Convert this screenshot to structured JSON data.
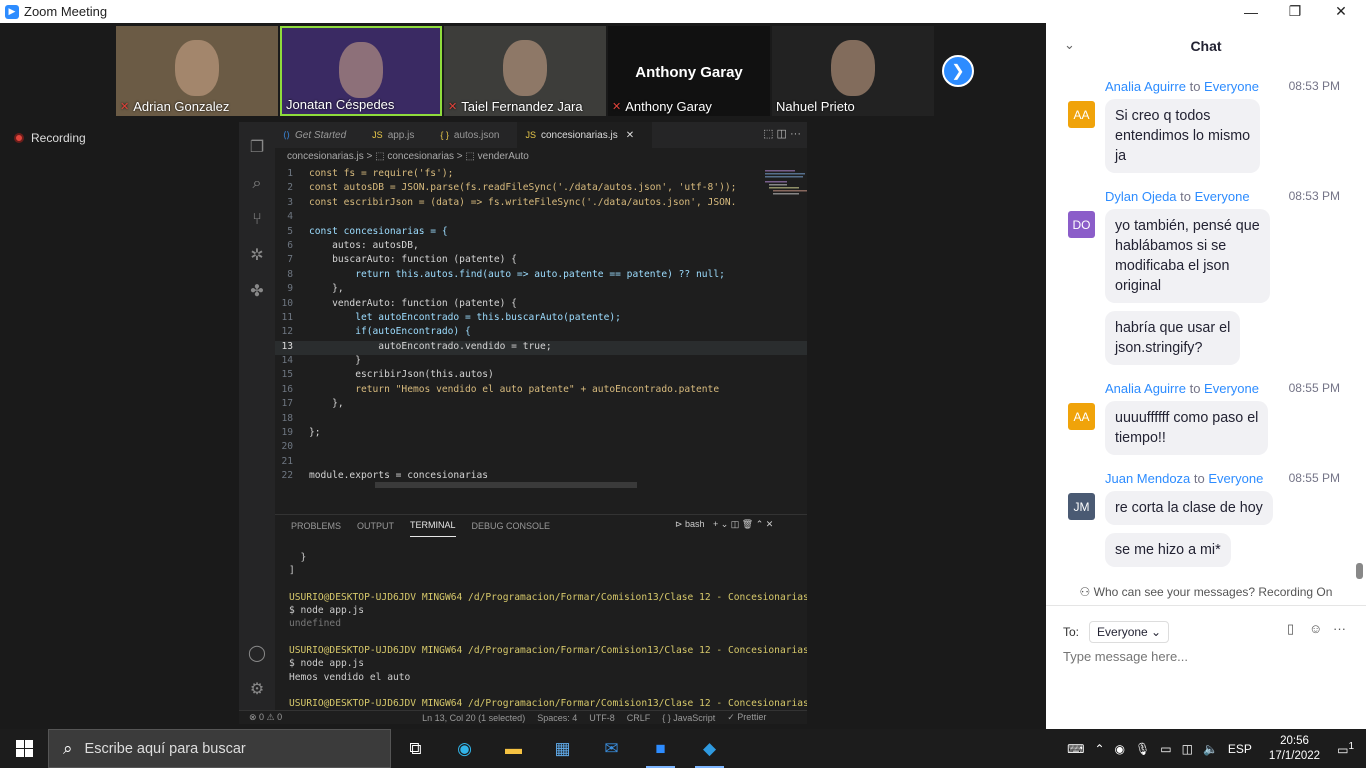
{
  "window": {
    "title": "Zoom Meeting",
    "minimize": "—",
    "restore": "❐",
    "close": "✕"
  },
  "participants": [
    {
      "name": "Adrian Gonzalez",
      "muted": true,
      "bg": "#6b5b45"
    },
    {
      "name": "Jonatan Céspedes",
      "muted": false,
      "active": true,
      "bg": "#3a2a63"
    },
    {
      "name": "Taiel Fernandez Jara",
      "muted": true,
      "bg": "#3d3d3a"
    },
    {
      "name": "Anthony Garay",
      "muted": true,
      "label": "Anthony Garay",
      "bg": "#111111"
    },
    {
      "name": "Nahuel Prieto",
      "muted": false,
      "bg": "#222222"
    }
  ],
  "recording": "Recording",
  "editor": {
    "tabs": [
      {
        "label": "Get Started",
        "icon": "⟨⟩",
        "color": "#3b8eea"
      },
      {
        "label": "app.js",
        "icon": "JS",
        "color": "#e8c84a"
      },
      {
        "label": "autos.json",
        "icon": "{ }",
        "color": "#e8c84a"
      },
      {
        "label": "concesionarias.js",
        "icon": "JS",
        "color": "#e8c84a",
        "active": true,
        "close": "✕"
      }
    ],
    "breadcrumb": "concesionarias.js  >  ⬚ concesionarias  >  ⬚ venderAuto",
    "lines": [
      {
        "n": "1",
        "t": "const fs = require('fs');"
      },
      {
        "n": "2",
        "t": "const autosDB = JSON.parse(fs.readFileSync('./data/autos.json', 'utf-8'));"
      },
      {
        "n": "3",
        "t": "const escribirJson = (data) => fs.writeFileSync('./data/autos.json', JSON."
      },
      {
        "n": "4",
        "t": ""
      },
      {
        "n": "5",
        "t": "const concesionarias = {"
      },
      {
        "n": "6",
        "t": "    autos: autosDB,"
      },
      {
        "n": "7",
        "t": "    buscarAuto: function (patente) {"
      },
      {
        "n": "8",
        "t": "        return this.autos.find(auto => auto.patente == patente) ?? null;"
      },
      {
        "n": "9",
        "t": "    },"
      },
      {
        "n": "10",
        "t": "    venderAuto: function (patente) {"
      },
      {
        "n": "11",
        "t": "        let autoEncontrado = this.buscarAuto(patente);"
      },
      {
        "n": "12",
        "t": "        if(autoEncontrado) {"
      },
      {
        "n": "13",
        "t": "            autoEncontrado.vendido = true;",
        "cur": true
      },
      {
        "n": "14",
        "t": "        }"
      },
      {
        "n": "15",
        "t": "        escribirJson(this.autos)"
      },
      {
        "n": "16",
        "t": "        return \"Hemos vendido el auto patente\" + autoEncontrado.patente"
      },
      {
        "n": "17",
        "t": "    },"
      },
      {
        "n": "18",
        "t": ""
      },
      {
        "n": "19",
        "t": "};"
      },
      {
        "n": "20",
        "t": ""
      },
      {
        "n": "21",
        "t": ""
      },
      {
        "n": "22",
        "t": "module.exports = concesionarias"
      }
    ],
    "panel_tabs": [
      "PROBLEMS",
      "OUTPUT",
      "TERMINAL",
      "DEBUG CONSOLE"
    ],
    "panel_shell": "bash",
    "terminal": [
      {
        "t": "  }",
        "dim": false
      },
      {
        "t": "]",
        "dim": false
      },
      {
        "t": "",
        "dim": false
      },
      {
        "t": "USURIO@DESKTOP-UJD6JDV MINGW64 /d/Programacion/Formar/Comision13/Clase 12 - Concesionarias",
        "prompt": true
      },
      {
        "t": "$ node app.js",
        "dim": false
      },
      {
        "t": "undefined",
        "dim": true
      },
      {
        "t": "",
        "dim": false
      },
      {
        "t": "USURIO@DESKTOP-UJD6JDV MINGW64 /d/Programacion/Formar/Comision13/Clase 12 - Concesionarias",
        "prompt": true
      },
      {
        "t": "$ node app.js",
        "dim": false
      },
      {
        "t": "Hemos vendido el auto",
        "dim": false
      },
      {
        "t": "",
        "dim": false
      },
      {
        "t": "USURIO@DESKTOP-UJD6JDV MINGW64 /d/Programacion/Formar/Comision13/Clase 12 - Concesionarias",
        "prompt": true
      },
      {
        "t": "$ ▯",
        "dim": false
      }
    ],
    "status": {
      "problems": "⊗ 0  ⚠ 0",
      "cursor": "Ln 13, Col 20 (1 selected)",
      "spaces": "Spaces: 4",
      "encoding": "UTF-8",
      "eol": "CRLF",
      "lang": "{ } JavaScript",
      "formatter": "✓ Prettier"
    }
  },
  "chat": {
    "title": "Chat",
    "messages": [
      {
        "sender": "Analia Aguirre",
        "to": "to",
        "recipient": "Everyone",
        "time": "08:53 PM",
        "initials": "AA",
        "color": "#f0a30a",
        "texts": [
          "Si creo q todos\nentendimos lo mismo\nja"
        ]
      },
      {
        "sender": "Dylan Ojeda",
        "to": "to",
        "recipient": "Everyone",
        "time": "08:53 PM",
        "initials": "DO",
        "color": "#8b5dc9",
        "texts": [
          "yo también, pensé que\nhablábamos si se\nmodificaba el json\noriginal",
          "habría que usar el\njson.stringify?"
        ]
      },
      {
        "sender": "Analia Aguirre",
        "to": "to",
        "recipient": "Everyone",
        "time": "08:55 PM",
        "initials": "AA",
        "color": "#f0a30a",
        "texts": [
          "uuuuffffff como paso el\ntiempo!!"
        ]
      },
      {
        "sender": "Juan Mendoza",
        "to": "to",
        "recipient": "Everyone",
        "time": "08:55 PM",
        "initials": "JM",
        "color": "#4a5a73",
        "texts": [
          "re corta la clase de hoy",
          "se me hizo a mi*"
        ]
      }
    ],
    "privacy": "Who can see your messages? Recording On",
    "to_label": "To:",
    "to_value": "Everyone",
    "placeholder": "Type message here..."
  },
  "taskbar": {
    "search_placeholder": "Escribe aquí para buscar",
    "lang": "ESP",
    "time": "20:56",
    "date": "17/1/2022",
    "notifications": "1"
  }
}
